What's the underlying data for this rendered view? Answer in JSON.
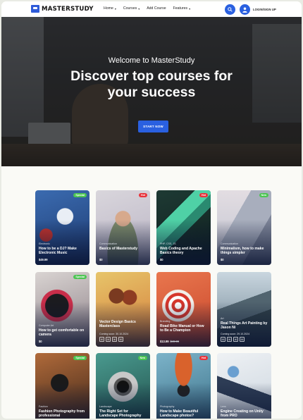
{
  "header": {
    "logo": "MASTERSTUDY",
    "nav": [
      {
        "label": "Home",
        "has_dropdown": true
      },
      {
        "label": "Courses",
        "has_dropdown": true
      },
      {
        "label": "Add Course",
        "has_dropdown": false
      },
      {
        "label": "Features",
        "has_dropdown": true
      }
    ],
    "login_label": "LOGIN/SIGN UP",
    "search_icon": "search-icon",
    "user_icon": "user-icon",
    "accent": "#2a60e0"
  },
  "hero": {
    "subtitle": "Welcome to MasterStudy",
    "title_line1": "Discover top courses for",
    "title_line2": "your success",
    "cta": "START NOW"
  },
  "courses": [
    {
      "category": "Electronic",
      "title": "How to be a DJ? Make Electronic Music",
      "price": "$49.99",
      "badge": "Special",
      "badge_color": "#4cc552"
    },
    {
      "category": "Communication",
      "title": "Basics of Masterstudy",
      "price": "$0",
      "badge": "Hot",
      "badge_color": "#e8333b"
    },
    {
      "category": "PHP, CSS, JS",
      "title": "Web Coding and Apache Basics theory",
      "price": "$0",
      "badge": "Hot",
      "badge_color": "#e8333b"
    },
    {
      "category": "Communication",
      "title": "Minimalism, how to make things simpler",
      "price": "$0",
      "badge": "New",
      "badge_color": "#4cc552"
    },
    {
      "category": "Computer Art",
      "title": "How to get comfortable on camera",
      "price": "$0",
      "badge": "Special",
      "badge_color": "#4cc552"
    },
    {
      "category": "",
      "title": "Vector Design Basics Masterclass",
      "coming_soon": "Coming soon: 30.10.2024",
      "timer": [
        "00",
        "00",
        "00",
        "00"
      ]
    },
    {
      "category": "Branding",
      "title": "Road Bike Manual or How to Be a Champion",
      "price": "$13.99",
      "old_price": "$49.99"
    },
    {
      "category": "Art",
      "title": "Real Things Art Painting by Jason Ni",
      "coming_soon": "Coming soon: 29.10.2024",
      "timer": [
        "00",
        "00",
        "00",
        "00"
      ]
    },
    {
      "category": "Fashion",
      "title": "Fashion Photography from professional",
      "badge": "Special",
      "badge_color": "#4cc552"
    },
    {
      "category": "Landscape",
      "title": "The Right Set for Landscape Photography",
      "badge": "New",
      "badge_color": "#4cc552"
    },
    {
      "category": "Photography",
      "title": "How to Make Beautiful Landscape photos?",
      "badge": "Hot",
      "badge_color": "#e8333b"
    },
    {
      "category": "Lens",
      "title": "Engine Creating on Unity from PRO"
    }
  ]
}
